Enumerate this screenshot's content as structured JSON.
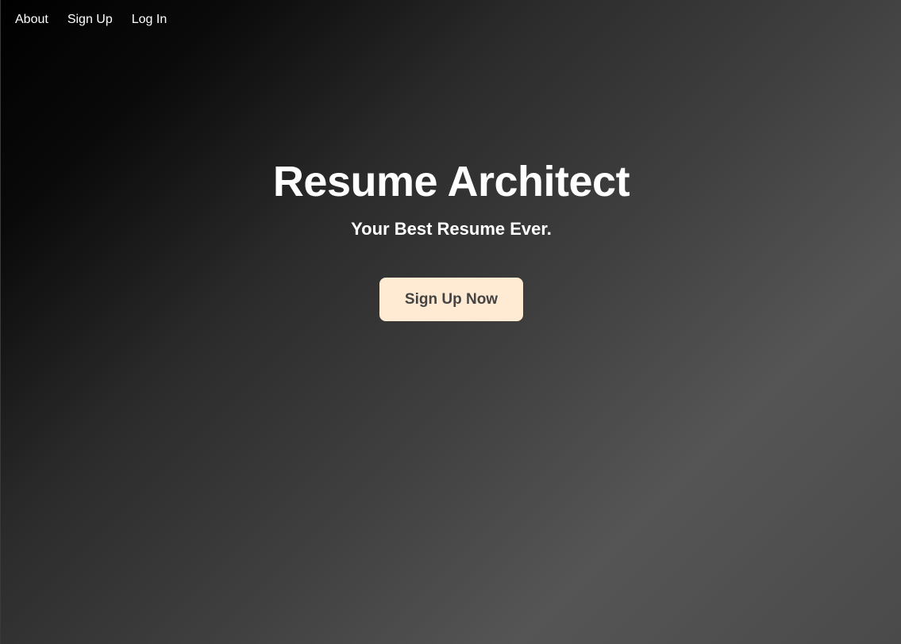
{
  "nav": {
    "items": [
      {
        "label": "About"
      },
      {
        "label": "Sign Up"
      },
      {
        "label": "Log In"
      }
    ]
  },
  "hero": {
    "title": "Resume Architect",
    "subtitle": "Your Best Resume Ever.",
    "cta_label": "Sign Up Now"
  },
  "colors": {
    "cta_background": "#ffebd3",
    "cta_text": "#444444",
    "text": "#ffffff"
  }
}
